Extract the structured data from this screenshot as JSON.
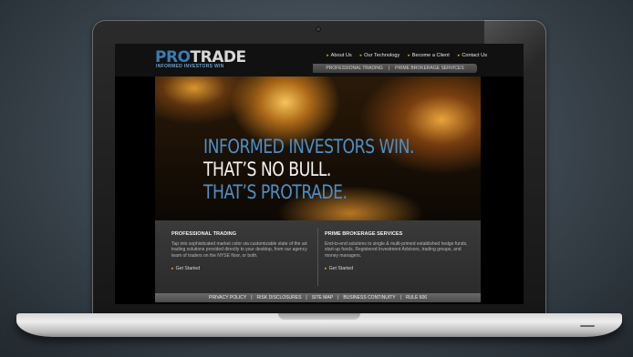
{
  "logo": {
    "part1": "PRO",
    "part2": "TRADE",
    "tagline": "INFORMED INVESTORS WIN"
  },
  "top_nav": [
    "About Us",
    "Our Technology",
    "Become a Client",
    "Contact Us"
  ],
  "service_bar": {
    "item1": "PROFESSIONAL TRADING",
    "separator": "|",
    "item2": "PRIME BROKERAGE SERVICES"
  },
  "hero": {
    "line1": "INFORMED INVESTORS WIN.",
    "line2": "THAT’S NO BULL.",
    "line3": "THAT’S PROTRADE."
  },
  "panels": {
    "left": {
      "title": "PROFESSIONAL TRADING",
      "body": "Tap into sophisticated market color via customizable state of the art trading solutions provided directly to your desktop, from our agency team of traders on the NYSE floor, or both.",
      "cta": "Get Started"
    },
    "right": {
      "title": "PRIME BROKERAGE SERVICES",
      "body": "End-to-end solutions to single & multi-primed established hedge funds, start-up funds, Registered Investment Advisors, trading groups, and money managers.",
      "cta": "Get Started"
    }
  },
  "footer_links": [
    "PRIVACY POLICY",
    "|",
    "RISK DISCLOSURES",
    "|",
    "SITE MAP",
    "|",
    "BUSINESS CONTINUITY",
    "|",
    "RULE 606"
  ],
  "colors": {
    "brand_blue": "#4d8fc7",
    "accent_orange": "#e2a21b",
    "header_bg": "#111111",
    "panel_bg": "#333333"
  },
  "icons": {
    "nav_bullet": "orange-arrow-bullet",
    "cta_bullet": "orange-arrow-bullet"
  }
}
